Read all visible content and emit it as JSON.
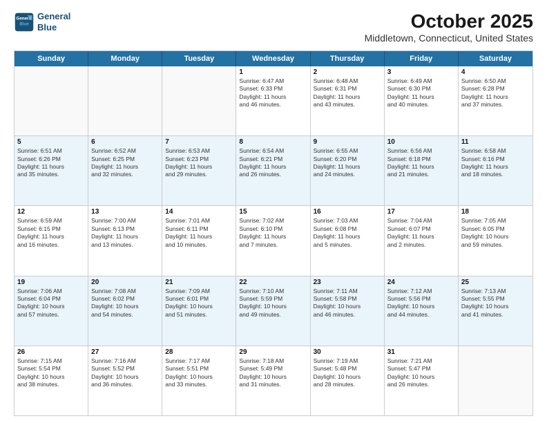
{
  "header": {
    "logo_line1": "General",
    "logo_line2": "Blue",
    "month": "October 2025",
    "location": "Middletown, Connecticut, United States"
  },
  "weekdays": [
    "Sunday",
    "Monday",
    "Tuesday",
    "Wednesday",
    "Thursday",
    "Friday",
    "Saturday"
  ],
  "rows": [
    [
      {
        "day": "",
        "info": "",
        "empty": true
      },
      {
        "day": "",
        "info": "",
        "empty": true
      },
      {
        "day": "",
        "info": "",
        "empty": true
      },
      {
        "day": "1",
        "info": "Sunrise: 6:47 AM\nSunset: 6:33 PM\nDaylight: 11 hours\nand 46 minutes.",
        "empty": false
      },
      {
        "day": "2",
        "info": "Sunrise: 6:48 AM\nSunset: 6:31 PM\nDaylight: 11 hours\nand 43 minutes.",
        "empty": false
      },
      {
        "day": "3",
        "info": "Sunrise: 6:49 AM\nSunset: 6:30 PM\nDaylight: 11 hours\nand 40 minutes.",
        "empty": false
      },
      {
        "day": "4",
        "info": "Sunrise: 6:50 AM\nSunset: 6:28 PM\nDaylight: 11 hours\nand 37 minutes.",
        "empty": false
      }
    ],
    [
      {
        "day": "5",
        "info": "Sunrise: 6:51 AM\nSunset: 6:26 PM\nDaylight: 11 hours\nand 35 minutes.",
        "empty": false
      },
      {
        "day": "6",
        "info": "Sunrise: 6:52 AM\nSunset: 6:25 PM\nDaylight: 11 hours\nand 32 minutes.",
        "empty": false
      },
      {
        "day": "7",
        "info": "Sunrise: 6:53 AM\nSunset: 6:23 PM\nDaylight: 11 hours\nand 29 minutes.",
        "empty": false
      },
      {
        "day": "8",
        "info": "Sunrise: 6:54 AM\nSunset: 6:21 PM\nDaylight: 11 hours\nand 26 minutes.",
        "empty": false
      },
      {
        "day": "9",
        "info": "Sunrise: 6:55 AM\nSunset: 6:20 PM\nDaylight: 11 hours\nand 24 minutes.",
        "empty": false
      },
      {
        "day": "10",
        "info": "Sunrise: 6:56 AM\nSunset: 6:18 PM\nDaylight: 11 hours\nand 21 minutes.",
        "empty": false
      },
      {
        "day": "11",
        "info": "Sunrise: 6:58 AM\nSunset: 6:16 PM\nDaylight: 11 hours\nand 18 minutes.",
        "empty": false
      }
    ],
    [
      {
        "day": "12",
        "info": "Sunrise: 6:59 AM\nSunset: 6:15 PM\nDaylight: 11 hours\nand 16 minutes.",
        "empty": false
      },
      {
        "day": "13",
        "info": "Sunrise: 7:00 AM\nSunset: 6:13 PM\nDaylight: 11 hours\nand 13 minutes.",
        "empty": false
      },
      {
        "day": "14",
        "info": "Sunrise: 7:01 AM\nSunset: 6:11 PM\nDaylight: 11 hours\nand 10 minutes.",
        "empty": false
      },
      {
        "day": "15",
        "info": "Sunrise: 7:02 AM\nSunset: 6:10 PM\nDaylight: 11 hours\nand 7 minutes.",
        "empty": false
      },
      {
        "day": "16",
        "info": "Sunrise: 7:03 AM\nSunset: 6:08 PM\nDaylight: 11 hours\nand 5 minutes.",
        "empty": false
      },
      {
        "day": "17",
        "info": "Sunrise: 7:04 AM\nSunset: 6:07 PM\nDaylight: 11 hours\nand 2 minutes.",
        "empty": false
      },
      {
        "day": "18",
        "info": "Sunrise: 7:05 AM\nSunset: 6:05 PM\nDaylight: 10 hours\nand 59 minutes.",
        "empty": false
      }
    ],
    [
      {
        "day": "19",
        "info": "Sunrise: 7:06 AM\nSunset: 6:04 PM\nDaylight: 10 hours\nand 57 minutes.",
        "empty": false
      },
      {
        "day": "20",
        "info": "Sunrise: 7:08 AM\nSunset: 6:02 PM\nDaylight: 10 hours\nand 54 minutes.",
        "empty": false
      },
      {
        "day": "21",
        "info": "Sunrise: 7:09 AM\nSunset: 6:01 PM\nDaylight: 10 hours\nand 51 minutes.",
        "empty": false
      },
      {
        "day": "22",
        "info": "Sunrise: 7:10 AM\nSunset: 5:59 PM\nDaylight: 10 hours\nand 49 minutes.",
        "empty": false
      },
      {
        "day": "23",
        "info": "Sunrise: 7:11 AM\nSunset: 5:58 PM\nDaylight: 10 hours\nand 46 minutes.",
        "empty": false
      },
      {
        "day": "24",
        "info": "Sunrise: 7:12 AM\nSunset: 5:56 PM\nDaylight: 10 hours\nand 44 minutes.",
        "empty": false
      },
      {
        "day": "25",
        "info": "Sunrise: 7:13 AM\nSunset: 5:55 PM\nDaylight: 10 hours\nand 41 minutes.",
        "empty": false
      }
    ],
    [
      {
        "day": "26",
        "info": "Sunrise: 7:15 AM\nSunset: 5:54 PM\nDaylight: 10 hours\nand 38 minutes.",
        "empty": false
      },
      {
        "day": "27",
        "info": "Sunrise: 7:16 AM\nSunset: 5:52 PM\nDaylight: 10 hours\nand 36 minutes.",
        "empty": false
      },
      {
        "day": "28",
        "info": "Sunrise: 7:17 AM\nSunset: 5:51 PM\nDaylight: 10 hours\nand 33 minutes.",
        "empty": false
      },
      {
        "day": "29",
        "info": "Sunrise: 7:18 AM\nSunset: 5:49 PM\nDaylight: 10 hours\nand 31 minutes.",
        "empty": false
      },
      {
        "day": "30",
        "info": "Sunrise: 7:19 AM\nSunset: 5:48 PM\nDaylight: 10 hours\nand 28 minutes.",
        "empty": false
      },
      {
        "day": "31",
        "info": "Sunrise: 7:21 AM\nSunset: 5:47 PM\nDaylight: 10 hours\nand 26 minutes.",
        "empty": false
      },
      {
        "day": "",
        "info": "",
        "empty": true
      }
    ]
  ]
}
